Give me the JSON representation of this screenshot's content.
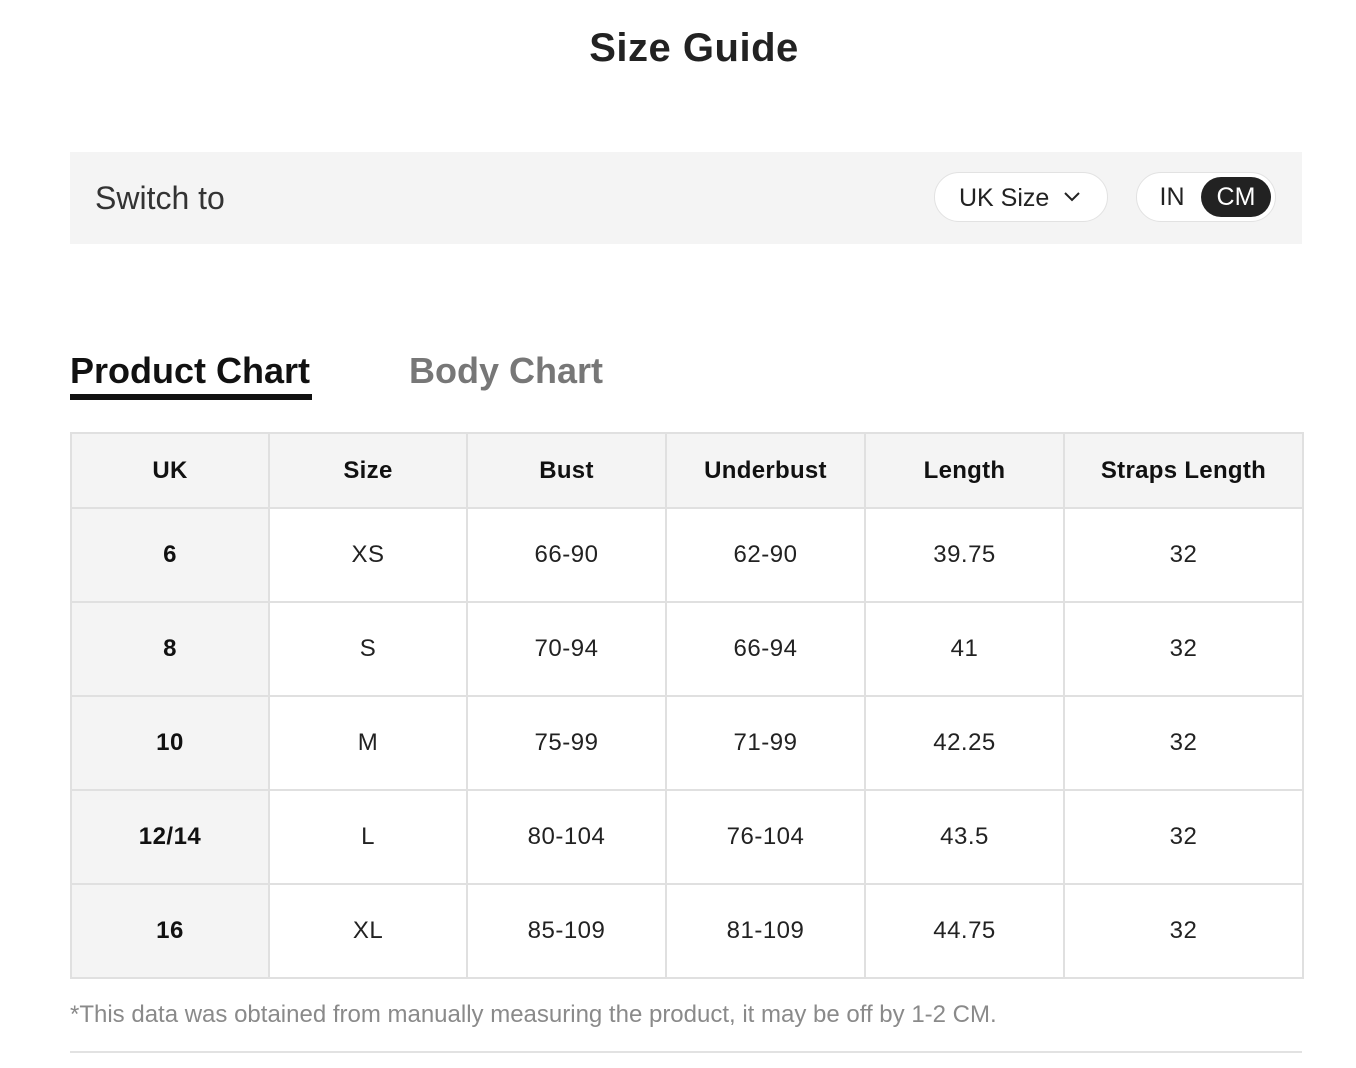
{
  "page": {
    "title": "Size Guide"
  },
  "switch_bar": {
    "label": "Switch to",
    "size_dropdown": {
      "selected": "UK Size",
      "icon": "chevron-down-icon"
    },
    "units": {
      "options": [
        "IN",
        "CM"
      ],
      "selected": "CM"
    }
  },
  "tabs": [
    {
      "label": "Product Chart",
      "active": true
    },
    {
      "label": "Body Chart",
      "active": false
    }
  ],
  "table": {
    "headers": [
      "UK",
      "Size",
      "Bust",
      "Underbust",
      "Length",
      "Straps Length"
    ],
    "rows": [
      [
        "6",
        "XS",
        "66-90",
        "62-90",
        "39.75",
        "32"
      ],
      [
        "8",
        "S",
        "70-94",
        "66-94",
        "41",
        "32"
      ],
      [
        "10",
        "M",
        "75-99",
        "71-99",
        "42.25",
        "32"
      ],
      [
        "12/14",
        "L",
        "80-104",
        "76-104",
        "43.5",
        "32"
      ],
      [
        "16",
        "XL",
        "85-109",
        "81-109",
        "44.75",
        "32"
      ]
    ]
  },
  "footnote": "*This data was obtained from manually measuring the product, it may be off by 1-2 CM.",
  "colors": {
    "accent": "#222222",
    "muted": "#777777",
    "panel": "#f4f4f4",
    "border": "#e0e0e0"
  }
}
